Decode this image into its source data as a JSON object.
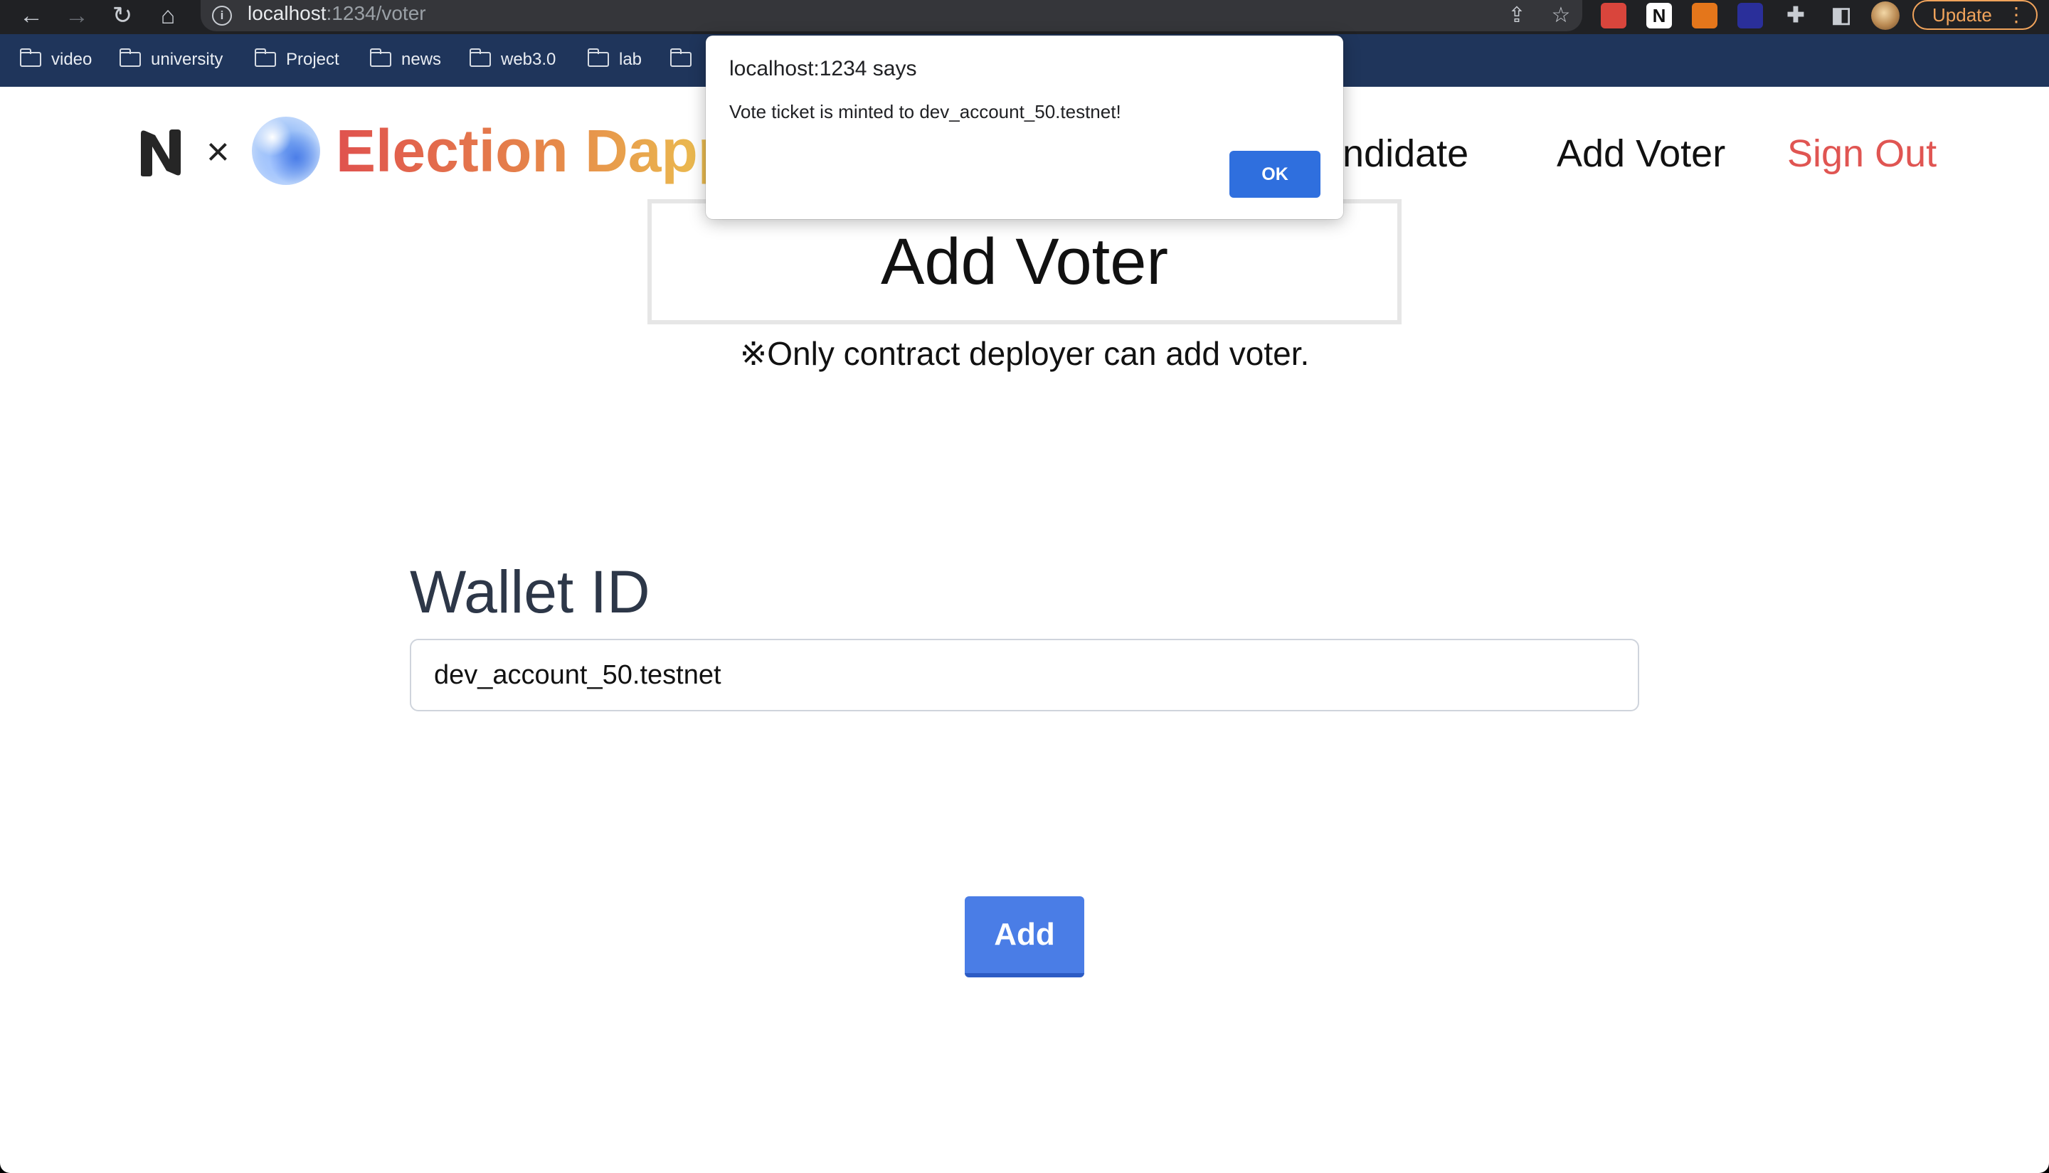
{
  "browser": {
    "url_host": "localhost",
    "url_path": ":1234/voter",
    "update_label": "Update",
    "bookmarks": [
      "video",
      "university",
      "Project",
      "news",
      "web3.0",
      "lab",
      ""
    ]
  },
  "header": {
    "times_glyph": "×",
    "brand": "Election Dapp",
    "nav": {
      "candidate": "Candidate",
      "add_voter": "Add Voter",
      "sign_out": "Sign Out"
    }
  },
  "main": {
    "title": "Add Voter",
    "note": "※Only contract deployer can add voter.",
    "wallet_label": "Wallet ID",
    "wallet_value": "dev_account_50.testnet",
    "add_button": "Add"
  },
  "dialog": {
    "title": "localhost:1234 says",
    "message": "Vote ticket is minted to dev_account_50.testnet!",
    "ok_label": "OK"
  },
  "colors": {
    "brand_gradient": [
      "#e0524e",
      "#ecc650"
    ],
    "sign_out": "#e05552",
    "primary_button": "#4a7de6",
    "dialog_ok": "#2f6fde",
    "bookmarks_bar": "#1f355b"
  }
}
